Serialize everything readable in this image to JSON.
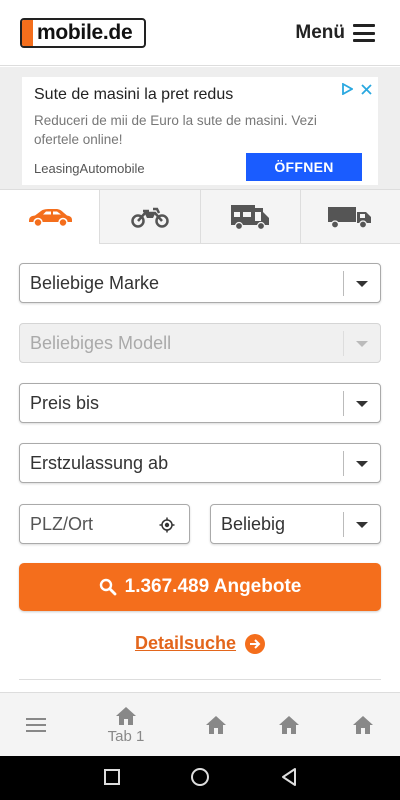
{
  "header": {
    "logo_text": "mobile.de",
    "menu_label": "Menü",
    "brand_color": "#f46e1c"
  },
  "ad": {
    "title": "Sute de masini la pret redus",
    "body": "Reduceri de mii de Euro la sute de masini. Vezi ofertele online!",
    "sponsor": "LeasingAutomobile",
    "button_label": "ÖFFNEN",
    "button_color": "#1a5cff",
    "badges": [
      "play-icon",
      "close-icon"
    ]
  },
  "vehicle_tabs": [
    {
      "icon": "car-icon",
      "active": true
    },
    {
      "icon": "motorbike-icon",
      "active": false
    },
    {
      "icon": "camper-icon",
      "active": false
    },
    {
      "icon": "truck-icon",
      "active": false
    }
  ],
  "form": {
    "make": "Beliebige Marke",
    "model": "Beliebiges Modell",
    "price": "Preis bis",
    "registration": "Erstzulassung ab",
    "zip_placeholder": "PLZ/Ort",
    "radius": "Beliebig"
  },
  "search_button": {
    "label": "1.367.489 Angebote",
    "icon": "search-icon"
  },
  "detail_link": "Detailsuche",
  "bottom_nav": {
    "tab1_label": "Tab 1",
    "items": [
      "menu-icon",
      "home-icon",
      "home-icon",
      "home-icon",
      "home-icon"
    ]
  },
  "system_nav": [
    "square-icon",
    "circle-icon",
    "back-triangle-icon"
  ]
}
